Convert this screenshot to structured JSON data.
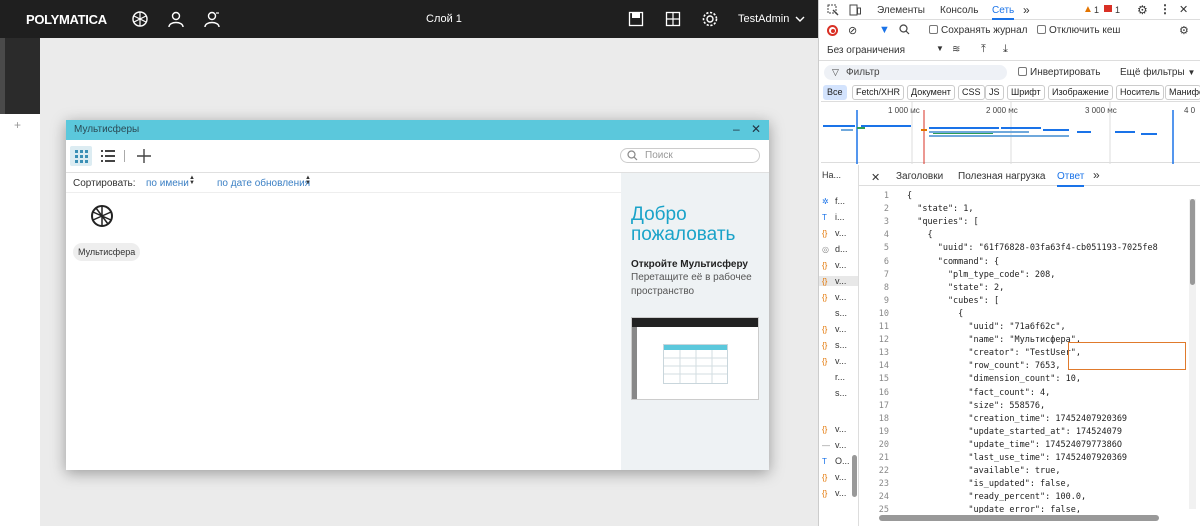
{
  "app": {
    "logo": "POLYMATICA",
    "layer_title": "Слой 1",
    "user": "TestAdmin",
    "add_layer": "+"
  },
  "dialog": {
    "title": "Мультисферы",
    "search_placeholder": "Поиск",
    "sort_label": "Сортировать:",
    "sort_by_name": "по имени",
    "sort_by_date": "по дате обновления",
    "item_name": "Мультисфера",
    "welcome_title": "Добро пожаловать",
    "welcome_subtitle": "Откройте Мультисферу",
    "welcome_text": "Перетащите её в рабочее пространство"
  },
  "devtools": {
    "tabs": [
      "Элементы",
      "Консоль",
      "Сеть"
    ],
    "more": "»",
    "warn_count": "1",
    "err_count": "1",
    "preserve_log": "Сохранять журнал",
    "disable_cache": "Отключить кеш",
    "throttle": "Без ограничения",
    "filter_placeholder": "Фильтр",
    "invert": "Инвертировать",
    "more_filters": "Ещё фильтры",
    "types": [
      "Все",
      "Fetch/XHR",
      "Документ",
      "CSS",
      "JS",
      "Шрифт",
      "Изображение",
      "Носитель",
      "Манифест"
    ],
    "timeline_labels": [
      "1 000 мс",
      "2 000 мс",
      "3 000 мс",
      "4 0"
    ],
    "name_col": "На...",
    "requests": [
      "f...",
      "i...",
      "v...",
      "d...",
      "v...",
      "v...",
      "v...",
      "s...",
      "v...",
      "s...",
      "v...",
      "r...",
      "s...",
      "v...",
      "v...",
      "O...",
      "v...",
      "v..."
    ],
    "resp_tabs": [
      "Заголовки",
      "Полезная нагрузка",
      "Ответ"
    ],
    "code_lines": [
      {
        "n": "1",
        "t": "{"
      },
      {
        "n": "2",
        "t": "  \"state\": 1,"
      },
      {
        "n": "3",
        "t": "  \"queries\": ["
      },
      {
        "n": "4",
        "t": "    {"
      },
      {
        "n": "5",
        "t": "      \"uuid\": \"61f76828-03fa63f4-cb051193-7025fe8"
      },
      {
        "n": "6",
        "t": "      \"command\": {"
      },
      {
        "n": "7",
        "t": "        \"plm_type_code\": 208,"
      },
      {
        "n": "8",
        "t": "        \"state\": 2,"
      },
      {
        "n": "9",
        "t": "        \"cubes\": ["
      },
      {
        "n": "10",
        "t": "          {"
      },
      {
        "n": "11",
        "t": "            \"uuid\": \"71a6f62c\","
      },
      {
        "n": "12",
        "t": "            \"name\": \"Мультисфера\","
      },
      {
        "n": "13",
        "t": "            \"creator\": \"TestUser\","
      },
      {
        "n": "14",
        "t": "            \"row_count\": 7653,"
      },
      {
        "n": "15",
        "t": "            \"dimension_count\": 10,"
      },
      {
        "n": "16",
        "t": "            \"fact_count\": 4,"
      },
      {
        "n": "17",
        "t": "            \"size\": 558576,"
      },
      {
        "n": "18",
        "t": "            \"creation_time\": 17452407920369"
      },
      {
        "n": "19",
        "t": "            \"update_started_at\": 174524079"
      },
      {
        "n": "20",
        "t": "            \"update_time\": 17452407977386O"
      },
      {
        "n": "21",
        "t": "            \"last_use_time\": 17452407920369"
      },
      {
        "n": "22",
        "t": "            \"available\": true,"
      },
      {
        "n": "23",
        "t": "            \"is_updated\": false,"
      },
      {
        "n": "24",
        "t": "            \"ready_percent\": 100.0,"
      },
      {
        "n": "25",
        "t": "            \"update_error\": false,"
      }
    ]
  }
}
